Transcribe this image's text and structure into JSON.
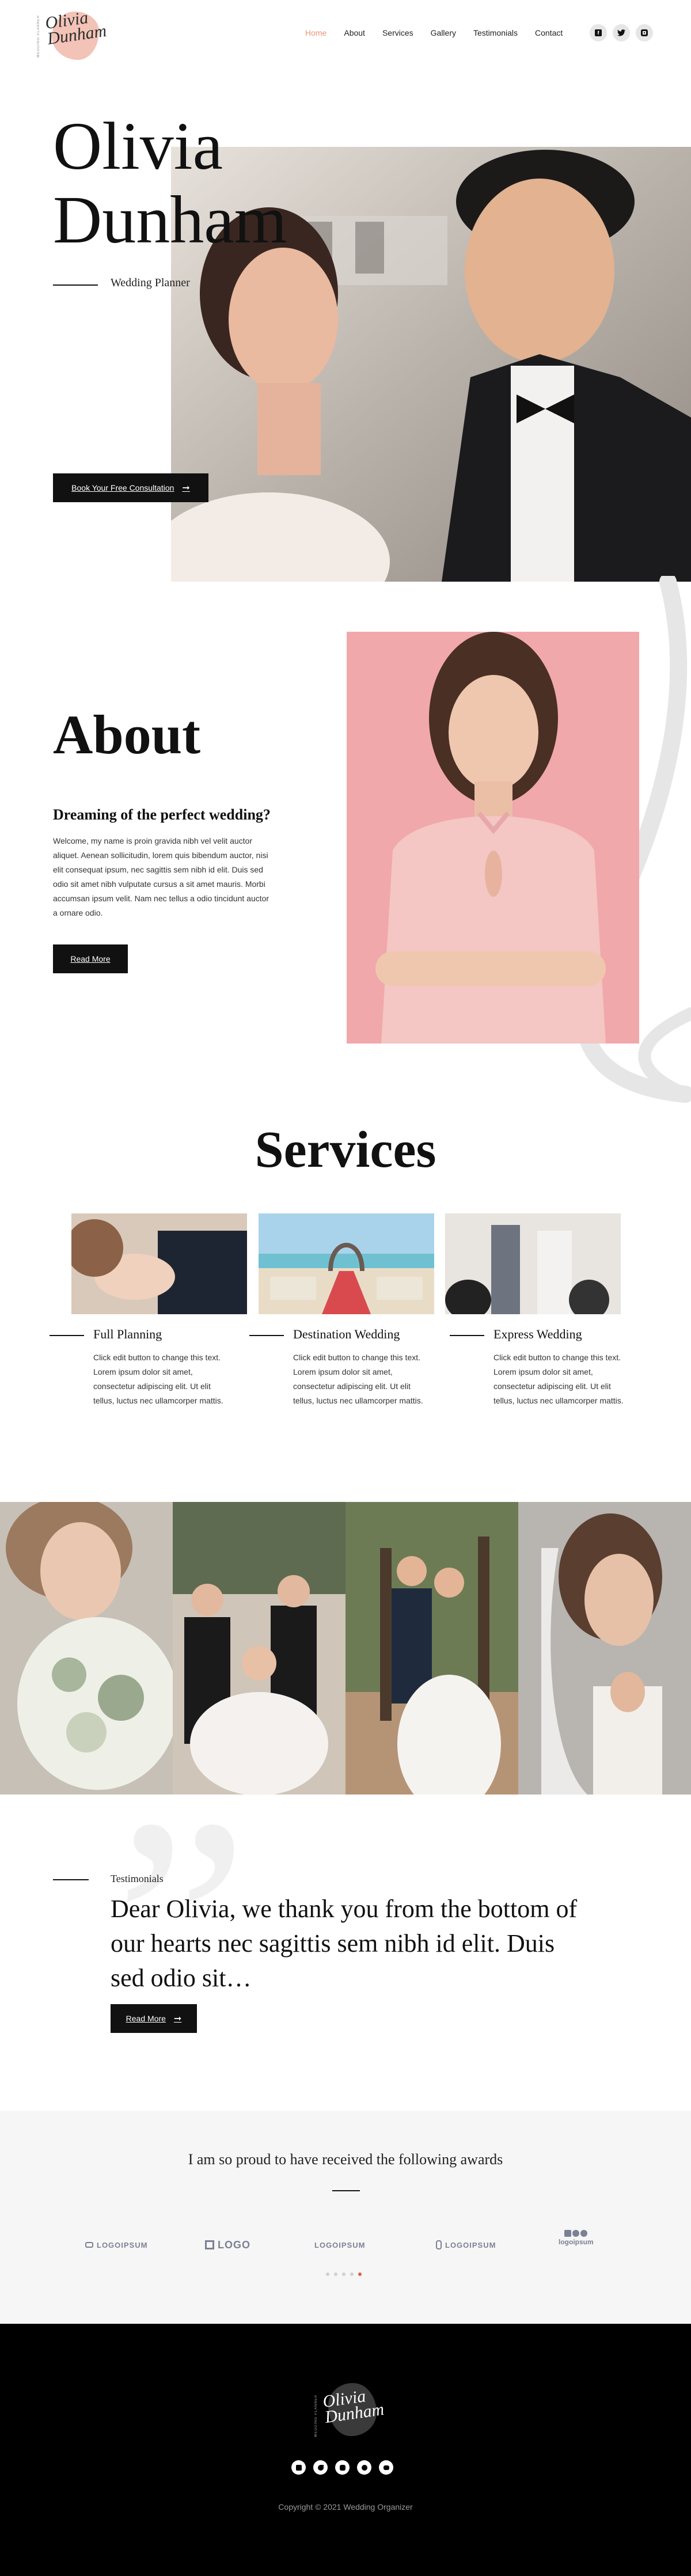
{
  "brand": {
    "logo_line1": "Olivia",
    "logo_line2": "Dunham",
    "logo_tagline": "WEDDING PLANNER"
  },
  "nav": {
    "items": [
      "Home",
      "About",
      "Services",
      "Gallery",
      "Testimonials",
      "Contact"
    ],
    "active": "Home"
  },
  "social_icons": [
    "facebook-icon",
    "twitter-icon",
    "instagram-icon"
  ],
  "hero": {
    "name_line1": "Olivia",
    "name_line2": "Dunham",
    "subtitle": "Wedding Planner",
    "cta_label": "Book Your Free Consultation"
  },
  "about": {
    "title": "About",
    "heading": "Dreaming of the perfect wedding?",
    "text": "Welcome, my name is proin gravida nibh vel velit auctor aliquet. Aenean sollicitudin, lorem quis bibendum auctor, nisi elit consequat ipsum, nec sagittis sem nibh id elit. Duis sed odio sit amet nibh vulputate cursus a sit amet mauris. Morbi accumsan ipsum velit. Nam nec tellus a odio tincidunt auctor a ornare odio.",
    "button_label": "Read More"
  },
  "services": {
    "title": "Services",
    "items": [
      {
        "name": "Full Planning",
        "text": "Click edit button to change this text. Lorem ipsum dolor sit amet, consectetur adipiscing elit. Ut elit tellus, luctus nec ullamcorper mattis."
      },
      {
        "name": "Destination Wedding",
        "text": "Click edit button to change this text. Lorem ipsum dolor sit amet, consectetur adipiscing elit. Ut elit tellus, luctus nec ullamcorper mattis."
      },
      {
        "name": "Express Wedding",
        "text": "Click edit button to change this text. Lorem ipsum dolor sit amet, consectetur adipiscing elit. Ut elit tellus, luctus nec ullamcorper mattis."
      }
    ]
  },
  "testimonials": {
    "label": "Testimonials",
    "quote": "Dear Olivia, we thank you from the bottom of our hearts nec sagittis sem nibh id elit. Duis sed odio sit…",
    "button_label": "Read More"
  },
  "awards": {
    "title": "I am so proud to have received the following awards",
    "logos": [
      "LOGOIPSUM",
      "LOGO",
      "LOGOIPSUM",
      "LOGOIPSUM",
      "logoipsum"
    ],
    "slides": 5,
    "active_slide": 5
  },
  "footer": {
    "social_icons": [
      "facebook-icon",
      "twitter-icon",
      "instagram-icon",
      "google-icon",
      "youtube-icon"
    ],
    "copyright": "Copyright © 2021 Wedding Organizer"
  },
  "colors": {
    "accent": "#e9967a",
    "dark": "#111111",
    "pink_bg": "#f1a8aa",
    "awards_bg": "#f6f6f6",
    "footer_bg": "#000000"
  }
}
